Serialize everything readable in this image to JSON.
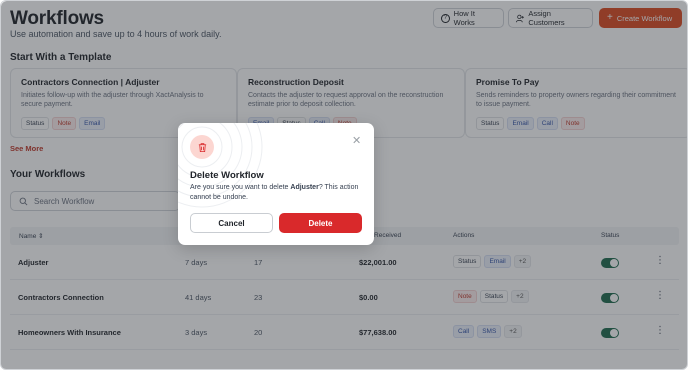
{
  "header": {
    "title": "Workflows",
    "subtitle": "Use automation and save up to 4 hours of work daily.",
    "how_it_works": "How It Works",
    "assign_customers": "Assign Customers",
    "create_workflow": "Create Workflow",
    "accent_color": "#dc4a22"
  },
  "templates": {
    "section_title": "Start With a Template",
    "see_more": "See More",
    "cards": [
      {
        "name": "Contractors Connection | Adjuster",
        "desc": "Initiates follow-up with the adjuster through XactAnalysis to secure payment.",
        "tags": [
          "Status",
          "Note",
          "Email"
        ]
      },
      {
        "name": "Reconstruction Deposit",
        "desc": "Contacts the adjuster to request approval on the reconstruction estimate prior to deposit collection.",
        "tags": [
          "Email",
          "Status",
          "Call",
          "Note"
        ]
      },
      {
        "name": "Promise To Pay",
        "desc": "Sends reminders to property owners regarding their commitment to issue payment.",
        "tags": [
          "Status",
          "Email",
          "Call",
          "Note"
        ]
      }
    ]
  },
  "your_workflows": {
    "section_title": "Your Workflows",
    "search_placeholder": "Search Workflow",
    "columns": {
      "name": "Name",
      "received": "y Received",
      "actions": "Actions",
      "status": "Status"
    },
    "rows": [
      {
        "name": "Adjuster",
        "days": "7 days",
        "count": "17",
        "received": "$22,001.00",
        "actions": [
          "Status",
          "Email",
          "+2"
        ],
        "status_on": true
      },
      {
        "name": "Contractors Connection",
        "days": "41 days",
        "count": "23",
        "received": "$0.00",
        "actions": [
          "Note",
          "Status",
          "+2"
        ],
        "status_on": true
      },
      {
        "name": "Homeowners With Insurance",
        "days": "3 days",
        "count": "20",
        "received": "$77,638.00",
        "actions": [
          "Call",
          "SMS",
          "+2"
        ],
        "status_on": true
      }
    ]
  },
  "modal": {
    "title": "Delete Workflow",
    "text_before": "Are you sure you want to delete ",
    "workflow_name": "Adjuster",
    "text_after": "? This action cannot be undone.",
    "cancel": "Cancel",
    "delete": "Delete",
    "danger_color": "#d9292b"
  }
}
